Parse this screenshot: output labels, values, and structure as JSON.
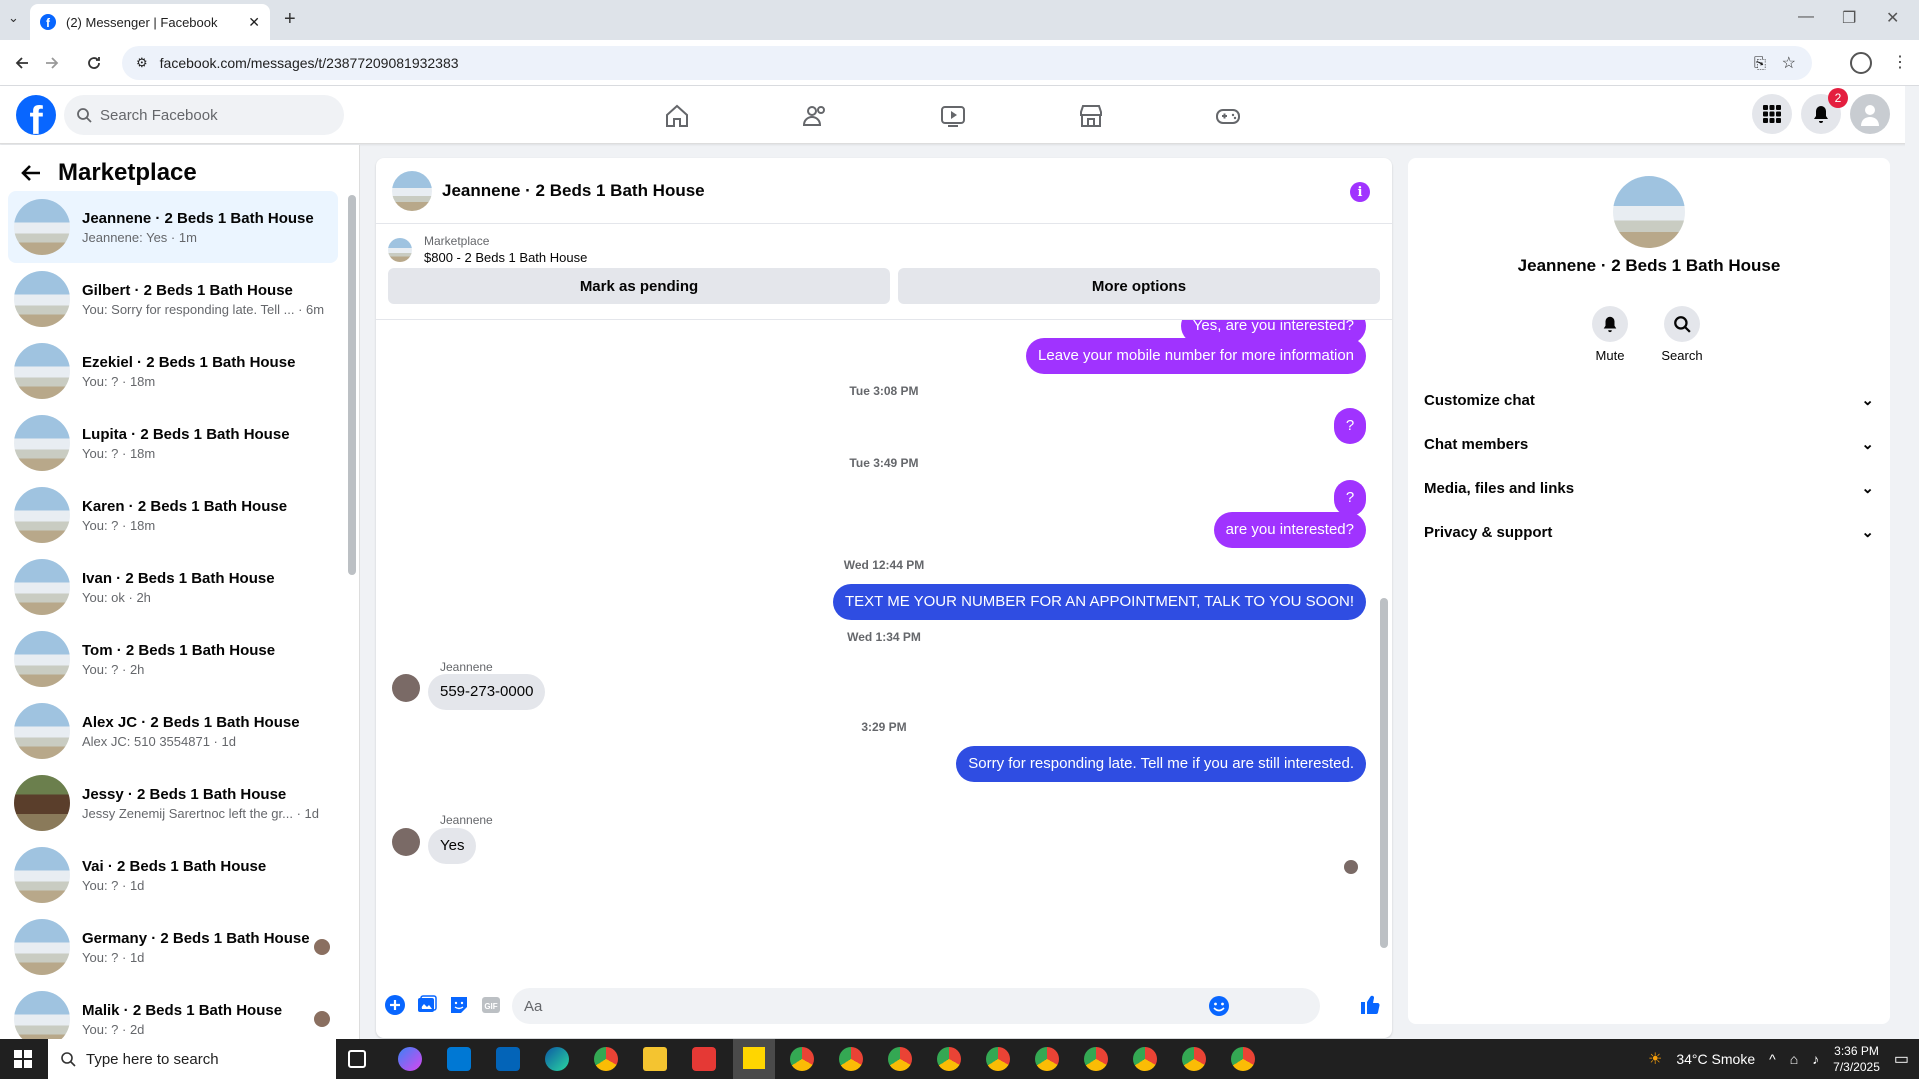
{
  "browser": {
    "tab_title": "(2) Messenger | Facebook",
    "url": "facebook.com/messages/t/23877209081932383"
  },
  "header": {
    "search_placeholder": "Search Facebook",
    "notif_count": "2"
  },
  "sidebar": {
    "title": "Marketplace",
    "conversations": [
      {
        "name": "Jeannene · 2 Beds 1 Bath House",
        "snippet": "Jeannene: Yes · 1m"
      },
      {
        "name": "Gilbert · 2 Beds 1 Bath House",
        "snippet": "You: Sorry for responding late. Tell ... · 6m"
      },
      {
        "name": "Ezekiel · 2 Beds 1 Bath House",
        "snippet": "You: ? · 18m"
      },
      {
        "name": "Lupita · 2 Beds 1 Bath House",
        "snippet": "You: ? · 18m"
      },
      {
        "name": "Karen · 2 Beds 1 Bath House",
        "snippet": "You: ? · 18m"
      },
      {
        "name": "Ivan · 2 Beds 1 Bath House",
        "snippet": "You: ok · 2h"
      },
      {
        "name": "Tom · 2 Beds 1 Bath House",
        "snippet": "You: ? · 2h"
      },
      {
        "name": "Alex JC · 2 Beds 1 Bath House",
        "snippet": "Alex JC: 510 3554871 · 1d"
      },
      {
        "name": "Jessy · 2 Beds 1 Bath House",
        "snippet": "Jessy Zenemij Sarertnoc left the gr... · 1d"
      },
      {
        "name": "Vai · 2 Beds 1 Bath House",
        "snippet": "You: ? · 1d"
      },
      {
        "name": "Germany · 2 Beds 1 Bath House",
        "snippet": "You: ? · 1d"
      },
      {
        "name": "Malik · 2 Beds 1 Bath House",
        "snippet": "You: ? · 2d"
      }
    ]
  },
  "chat": {
    "title": "Jeannene · 2 Beds 1 Bath House",
    "listing_source": "Marketplace",
    "listing_price": "$800 - 2 Beds 1 Bath House",
    "mark_pending_label": "Mark as pending",
    "more_options_label": "More options",
    "messages": {
      "m0": "Yes, are you interested?",
      "m1": "Leave your mobile number for more information",
      "t1": "Tue 3:08 PM",
      "m2": "?",
      "t2": "Tue 3:49 PM",
      "m3": "?",
      "m4": "are you interested?",
      "t3": "Wed 12:44 PM",
      "m5": "TEXT ME YOUR NUMBER FOR AN APPOINTMENT, TALK TO YOU SOON!",
      "t4": "Wed 1:34 PM",
      "sender1": "Jeannene",
      "m6": "559-273-0000",
      "t5": "3:29 PM",
      "m7": "Sorry for responding late. Tell me if you are still interested.",
      "sender2": "Jeannene",
      "m8": "Yes"
    },
    "composer_placeholder": "Aa"
  },
  "details": {
    "name": "Jeannene · 2 Beds 1 Bath House",
    "mute_label": "Mute",
    "search_label": "Search",
    "sections": [
      "Customize chat",
      "Chat members",
      "Media, files and links",
      "Privacy & support"
    ]
  },
  "taskbar": {
    "search_placeholder": "Type here to search",
    "weather": "34°C  Smoke",
    "time": "3:36 PM",
    "date": "7/3/2025"
  },
  "colors": {
    "accent": "#a033ff",
    "brand": "#0866ff",
    "blue_bubble": "#2f4de2"
  }
}
